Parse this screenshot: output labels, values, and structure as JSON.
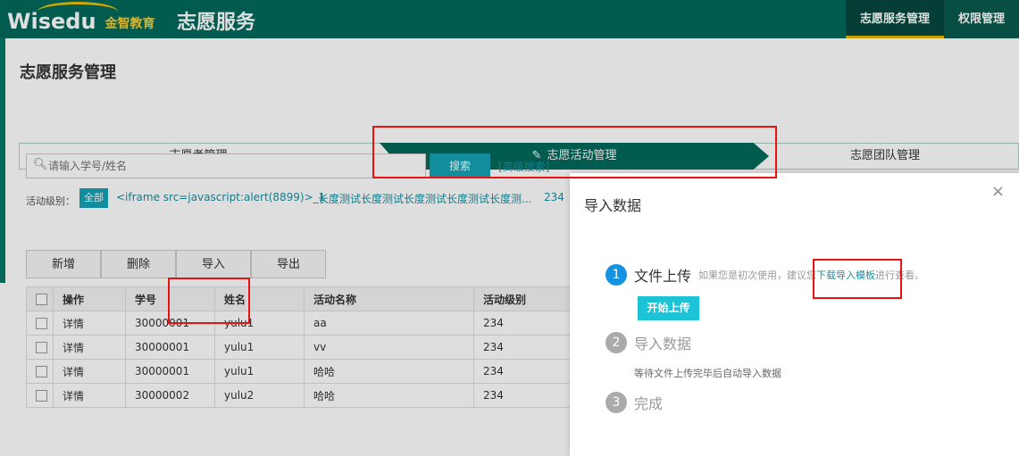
{
  "header": {
    "logo_word": "Wisedu",
    "logo_cn": "金智教育",
    "app_title": "志愿服务",
    "nav": [
      {
        "label": "志愿服务管理",
        "active": true
      },
      {
        "label": "权限管理",
        "active": false
      }
    ]
  },
  "page": {
    "title": "志愿服务管理",
    "steps": [
      "志愿者管理",
      "志愿活动管理",
      "志愿团队管理"
    ],
    "search_placeholder": "请输入学号/姓名",
    "search_button": "搜索",
    "advanced_search": "[高级搜索]",
    "filter_label": "活动级别：",
    "filter_all": "全部",
    "filter_options": [
      "<iframe src=javascript:alert(8899)>_1",
      "长度测试长度测试长度测试长度测试长度测...",
      "234"
    ],
    "toolbar": [
      "新增",
      "删除",
      "导入",
      "导出"
    ],
    "table": {
      "headers": [
        "操作",
        "学号",
        "姓名",
        "活动名称",
        "活动级别"
      ],
      "rows": [
        [
          "详情",
          "30000001",
          "yulu1",
          "aa",
          "234"
        ],
        [
          "详情",
          "30000001",
          "yulu1",
          "vv",
          "234"
        ],
        [
          "详情",
          "30000001",
          "yulu1",
          "哈哈",
          "234"
        ],
        [
          "详情",
          "30000002",
          "yulu2",
          "哈哈",
          "234"
        ]
      ]
    }
  },
  "modal": {
    "title": "导入数据",
    "close": "×",
    "step1": {
      "num": "1",
      "title": "文件上传",
      "hint_prefix": "如果您是初次使用，建议您",
      "hint_link": "下载导入模板",
      "hint_suffix": "进行查看。",
      "button": "开始上传"
    },
    "step2": {
      "num": "2",
      "title": "导入数据",
      "desc": "等待文件上传完毕后自动导入数据"
    },
    "step3": {
      "num": "3",
      "title": "完成"
    }
  },
  "colors": {
    "primary": "#02695a",
    "accent": "#14a3b5",
    "highlight": "#e81212"
  }
}
